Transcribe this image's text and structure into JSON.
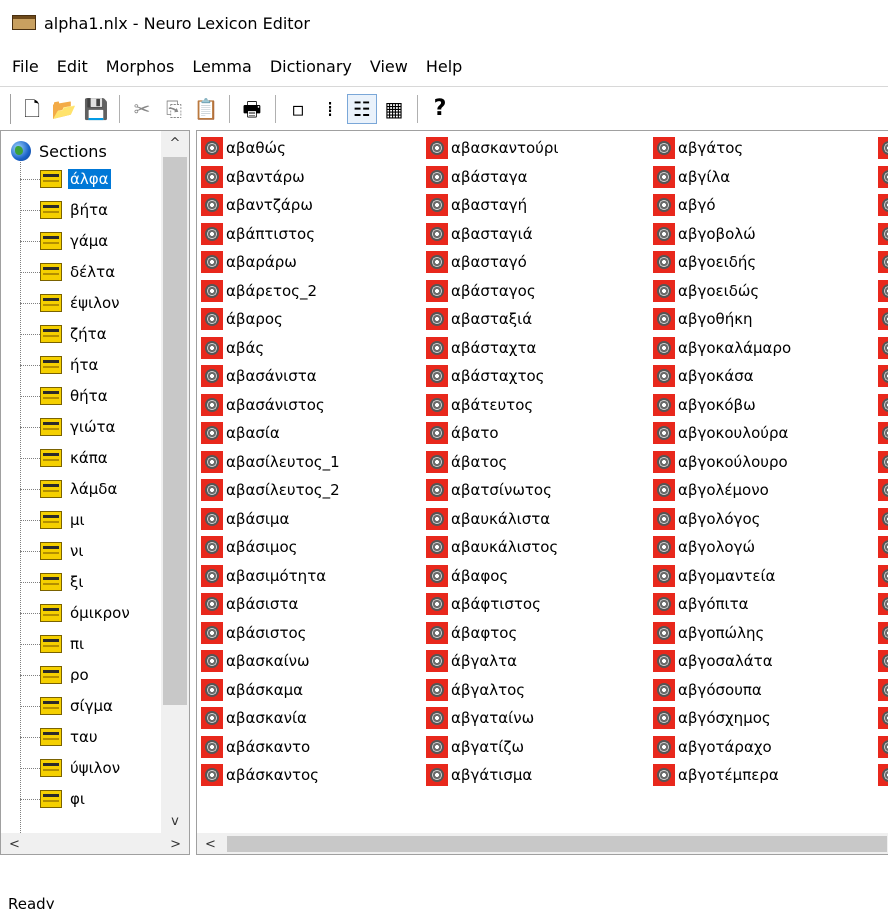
{
  "window": {
    "title": "alpha1.nlx - Neuro Lexicon Editor"
  },
  "menu": [
    "File",
    "Edit",
    "Morphos",
    "Lemma",
    "Dictionary",
    "View",
    "Help"
  ],
  "toolbar": {
    "buttons": [
      {
        "name": "new-document-icon",
        "glyph": "🗋"
      },
      {
        "name": "open-folder-icon",
        "glyph": "📂"
      },
      {
        "name": "save-icon",
        "glyph": "💾"
      },
      {
        "name": "cut-icon",
        "glyph": "✂"
      },
      {
        "name": "copy-icon",
        "glyph": "⎘"
      },
      {
        "name": "paste-icon",
        "glyph": "📋"
      },
      {
        "name": "print-icon",
        "glyph": "🖶"
      },
      {
        "name": "large-icons-view-icon",
        "glyph": "▫"
      },
      {
        "name": "small-icons-view-icon",
        "glyph": "⁞"
      },
      {
        "name": "list-view-icon",
        "glyph": "☷"
      },
      {
        "name": "details-view-icon",
        "glyph": "▦"
      },
      {
        "name": "help-icon",
        "glyph": "?"
      }
    ]
  },
  "tree": {
    "root_label": "Sections",
    "selected_index": 0,
    "items": [
      "άλφα",
      "βήτα",
      "γάμα",
      "δέλτα",
      "έψιλον",
      "ζήτα",
      "ήτα",
      "θήτα",
      "γιώτα",
      "κάπα",
      "λάμδα",
      "μι",
      "νι",
      "ξι",
      "όμικρον",
      "πι",
      "ρο",
      "σίγμα",
      "ταυ",
      "ύψιλον",
      "φι"
    ]
  },
  "words": {
    "columns": [
      [
        "αβαθώς",
        "αβαντάρω",
        "αβαντζάρω",
        "αβάπτιστος",
        "αβαράρω",
        "αβάρετος_2",
        "άβαρος",
        "αβάς",
        "αβασάνιστα",
        "αβασάνιστος",
        "αβασία",
        "αβασίλευτος_1",
        "αβασίλευτος_2",
        "αβάσιμα",
        "αβάσιμος",
        "αβασιμότητα",
        "αβάσιστα",
        "αβάσιστος",
        "αβασκαίνω",
        "αβάσκαμα",
        "αβασκανία",
        "αβάσκαντο",
        "αβάσκαντος"
      ],
      [
        "αβασκαντούρι",
        "αβάσταγα",
        "αβασταγή",
        "αβασταγιά",
        "αβασταγό",
        "αβάσταγος",
        "αβασταξιά",
        "αβάσταχτα",
        "αβάσταχτος",
        "αβάτευτος",
        "άβατο",
        "άβατος",
        "αβατσίνωτος",
        "αβαυκάλιστα",
        "αβαυκάλιστος",
        "άβαφος",
        "αβάφτιστος",
        "άβαφτος",
        "άβγαλτα",
        "άβγαλτος",
        "αβγαταίνω",
        "αβγατίζω",
        "αβγάτισμα"
      ],
      [
        "αβγάτος",
        "αβγίλα",
        "αβγό",
        "αβγοβολώ",
        "αβγοειδής",
        "αβγοειδώς",
        "αβγοθήκη",
        "αβγοκαλάμαρο",
        "αβγοκάσα",
        "αβγοκόβω",
        "αβγοκουλούρα",
        "αβγοκούλουρο",
        "αβγολέμονο",
        "αβγολόγος",
        "αβγολογώ",
        "αβγομαντεία",
        "αβγόπιτα",
        "αβγοπώλης",
        "αβγοσαλάτα",
        "αβγόσουπα",
        "αβγόσχημος",
        "αβγοτάραχο",
        "αβγοτέμπερα"
      ]
    ]
  },
  "scroll": {
    "up": "^",
    "down": "v",
    "left": "<",
    "right": ">"
  },
  "status": {
    "text": "Ready"
  }
}
